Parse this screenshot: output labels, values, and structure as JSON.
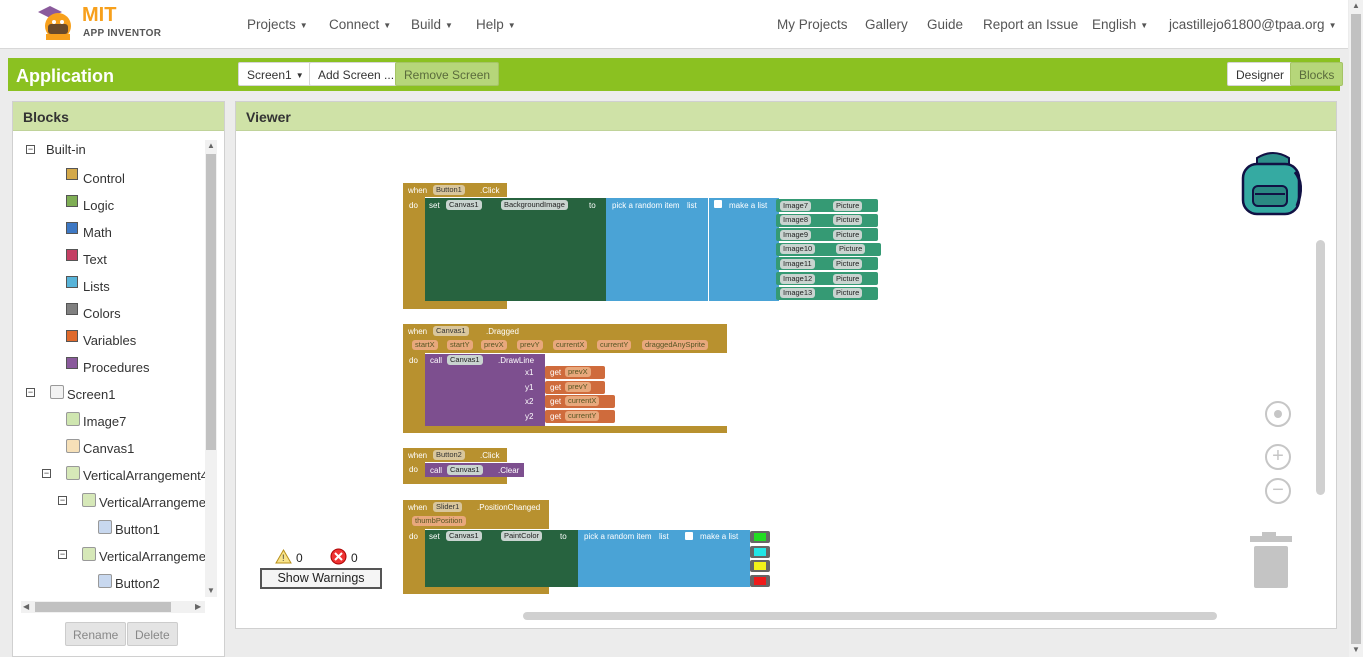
{
  "brand": {
    "name": "MIT",
    "sub": "APP INVENTOR"
  },
  "nav": {
    "projects": "Projects",
    "connect": "Connect",
    "build": "Build",
    "help": "Help",
    "my_projects": "My Projects",
    "gallery": "Gallery",
    "guide": "Guide",
    "report": "Report an Issue",
    "language": "English",
    "user": "jcastillejo61800@tpaa.org"
  },
  "appbar": {
    "title": "Application",
    "screen_select": "Screen1",
    "add_screen": "Add Screen ...",
    "remove_screen": "Remove Screen",
    "designer": "Designer",
    "blocks": "Blocks"
  },
  "blocks_panel": {
    "title": "Blocks",
    "builtin": "Built-in",
    "categories": [
      {
        "label": "Control",
        "color": "#d4a94a"
      },
      {
        "label": "Logic",
        "color": "#7fae55"
      },
      {
        "label": "Math",
        "color": "#3d78c4"
      },
      {
        "label": "Text",
        "color": "#c43f64"
      },
      {
        "label": "Lists",
        "color": "#58b4d9"
      },
      {
        "label": "Colors",
        "color": "#808080"
      },
      {
        "label": "Variables",
        "color": "#e06a2c"
      },
      {
        "label": "Procedures",
        "color": "#8a5a9c"
      }
    ],
    "components": [
      "Screen1",
      "Image7",
      "Canvas1",
      "VerticalArrangement4",
      "VerticalArrangemen",
      "Button1",
      "VerticalArrangemen",
      "Button2"
    ],
    "rename": "Rename",
    "delete": "Delete"
  },
  "viewer": {
    "title": "Viewer",
    "warnings_count": "0",
    "errors_count": "0",
    "show_warnings": "Show Warnings"
  },
  "blocks": {
    "b1": {
      "when": "when",
      "comp": "Button1",
      "event": ".Click",
      "do": "do",
      "set": "set",
      "target": "Canvas1",
      "prop": "BackgroundImage",
      "to": "to",
      "pick": "pick a random item",
      "list": "list",
      "make": "make a list",
      "items": [
        {
          "img": "Image7",
          "prop": "Picture"
        },
        {
          "img": "Image8",
          "prop": "Picture"
        },
        {
          "img": "Image9",
          "prop": "Picture"
        },
        {
          "img": "Image10",
          "prop": "Picture"
        },
        {
          "img": "Image11",
          "prop": "Picture"
        },
        {
          "img": "Image12",
          "prop": "Picture"
        },
        {
          "img": "Image13",
          "prop": "Picture"
        }
      ]
    },
    "b2": {
      "when": "when",
      "comp": "Canvas1",
      "event": ".Dragged",
      "params": [
        "startX",
        "startY",
        "prevX",
        "prevY",
        "currentX",
        "currentY",
        "draggedAnySprite"
      ],
      "do": "do",
      "call": "call",
      "target": "Canvas1",
      "method": ".DrawLine",
      "args": [
        {
          "name": "x1",
          "get": "get",
          "var": "prevX"
        },
        {
          "name": "y1",
          "get": "get",
          "var": "prevY"
        },
        {
          "name": "x2",
          "get": "get",
          "var": "currentX"
        },
        {
          "name": "y2",
          "get": "get",
          "var": "currentY"
        }
      ]
    },
    "b3": {
      "when": "when",
      "comp": "Button2",
      "event": ".Click",
      "do": "do",
      "call": "call",
      "target": "Canvas1",
      "method": ".Clear"
    },
    "b4": {
      "when": "when",
      "comp": "Slider1",
      "event": ".PositionChanged",
      "param": "thumbPosition",
      "do": "do",
      "set": "set",
      "target": "Canvas1",
      "prop": "PaintColor",
      "to": "to",
      "pick": "pick a random item",
      "list": "list",
      "make": "make a list",
      "colors": [
        "#22dd22",
        "#22e6e6",
        "#f2f21a",
        "#ee1a1a"
      ]
    }
  },
  "icons": {
    "backpack": "backpack-icon",
    "trash": "trash-icon",
    "warning": "warning-icon",
    "error": "error-icon"
  }
}
